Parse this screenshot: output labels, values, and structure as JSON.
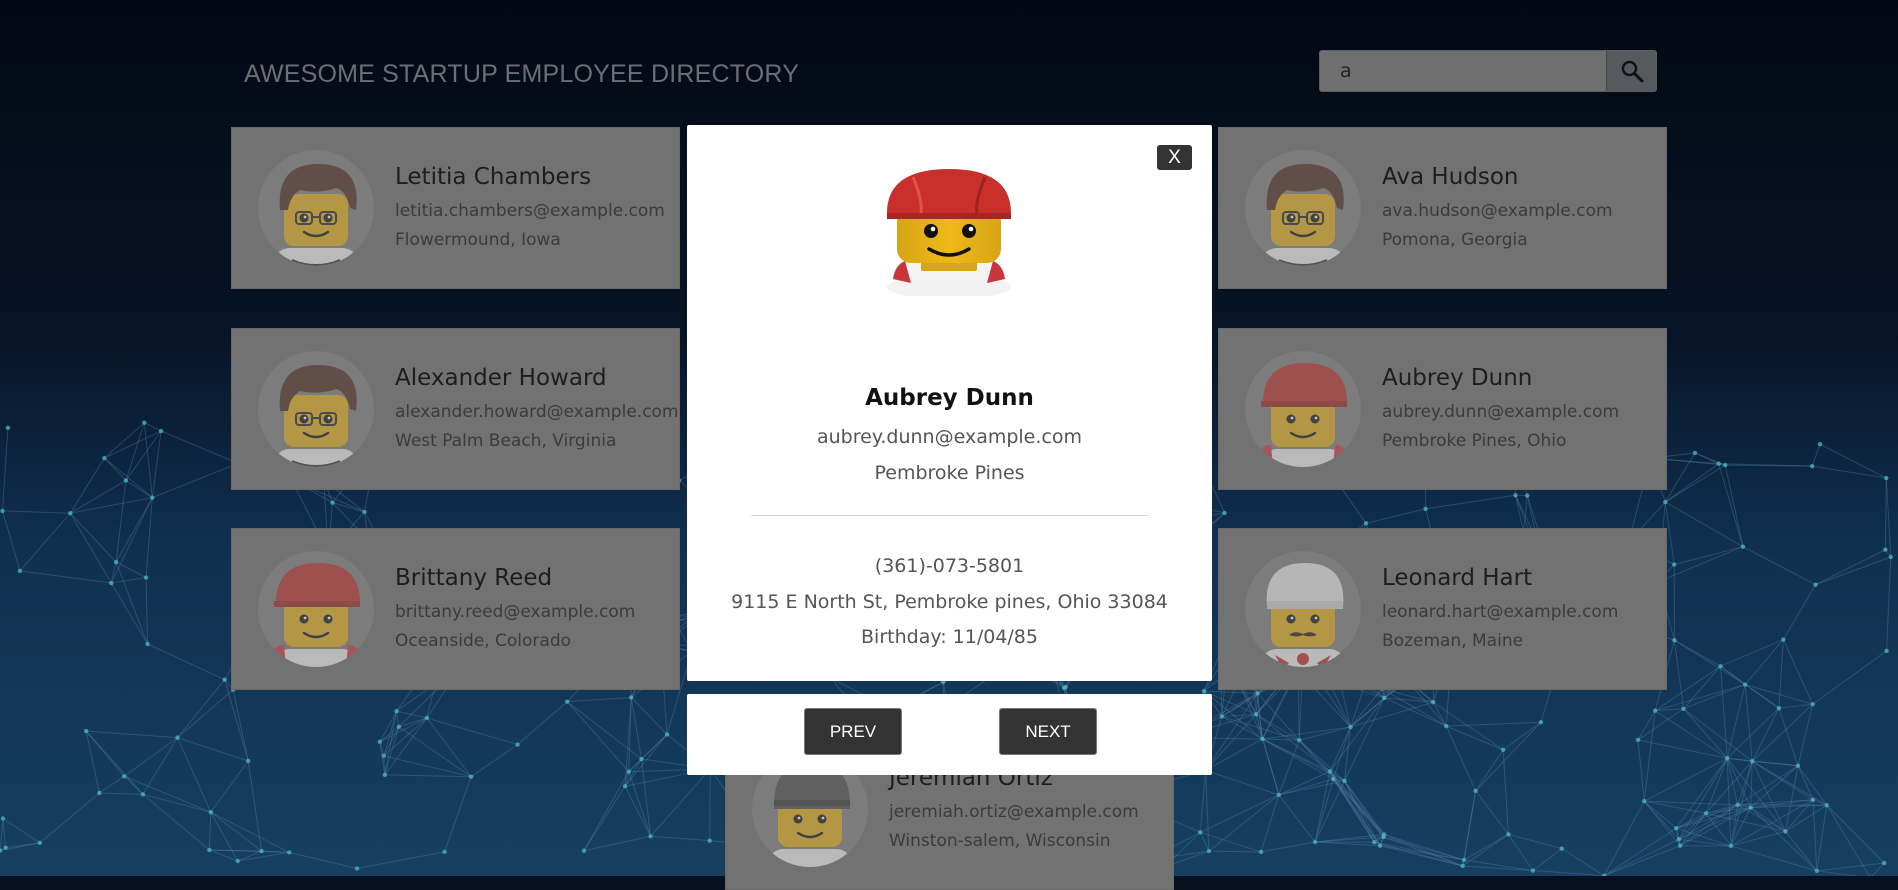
{
  "header": {
    "title": "AWESOME STARTUP EMPLOYEE DIRECTORY",
    "search_value": "a",
    "search_icon": "search-icon"
  },
  "employees": [
    {
      "name": "Letitia Chambers",
      "email": "letitia.chambers@example.com",
      "location": "Flowermound, Iowa",
      "avatar": "lego-brown-hair-glasses"
    },
    {
      "name": "Ava Hudson",
      "email": "ava.hudson@example.com",
      "location": "Pomona, Georgia",
      "avatar": "lego-brown-hair-glasses"
    },
    {
      "name": "Alexander Howard",
      "email": "alexander.howard@example.com",
      "location": "West Palm Beach, Virginia",
      "avatar": "lego-brown-hair-glasses"
    },
    {
      "name": "Aubrey Dunn",
      "email": "aubrey.dunn@example.com",
      "location": "Pembroke Pines, Ohio",
      "avatar": "lego-red-helmet"
    },
    {
      "name": "Brittany Reed",
      "email": "brittany.reed@example.com",
      "location": "Oceanside, Colorado",
      "avatar": "lego-red-helmet"
    },
    {
      "name": "Leonard Hart",
      "email": "leonard.hart@example.com",
      "location": "Bozeman, Maine",
      "avatar": "lego-chef-hat"
    },
    {
      "name": "Jeremiah Ortiz",
      "email": "jeremiah.ortiz@example.com",
      "location": "Winston-salem, Wisconsin",
      "avatar": "lego-grey-beanie"
    }
  ],
  "modal": {
    "close_label": "X",
    "name": "Aubrey Dunn",
    "email": "aubrey.dunn@example.com",
    "city": "Pembroke Pines",
    "phone": "(361)-073-5801",
    "address": "9115 E North St, Pembroke pines, Ohio 33084",
    "birthday": "Birthday: 11/04/85",
    "avatar": "lego-red-helmet"
  },
  "nav": {
    "prev_label": "PREV",
    "next_label": "NEXT"
  },
  "colors": {
    "accent_button": "#333333",
    "overlay_card": "#727272",
    "modal_bg": "#ffffff"
  }
}
